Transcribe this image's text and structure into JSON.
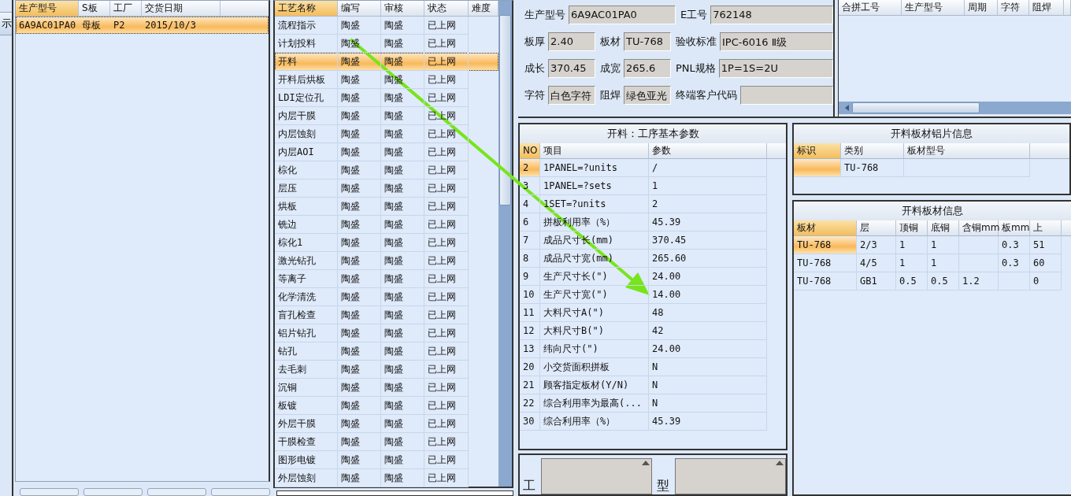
{
  "side_button": {
    "label": "示"
  },
  "orders": {
    "columns": [
      "生产型号",
      "S板",
      "工厂",
      "交货日期"
    ],
    "rows": [
      {
        "cells": [
          "6A9AC01PA0",
          "母板",
          "P2",
          "2015/10/3"
        ],
        "selected": true
      }
    ]
  },
  "processes": {
    "columns": [
      "工艺名称",
      "编写",
      "审核",
      "状态",
      "难度"
    ],
    "rows": [
      {
        "cells": [
          "流程指示",
          "陶盛",
          "陶盛",
          "已上网"
        ],
        "selected": false
      },
      {
        "cells": [
          "计划投料",
          "陶盛",
          "陶盛",
          "已上网"
        ],
        "selected": false
      },
      {
        "cells": [
          "开料",
          "陶盛",
          "陶盛",
          "已上网"
        ],
        "selected": true
      },
      {
        "cells": [
          "开料后烘板",
          "陶盛",
          "陶盛",
          "已上网"
        ],
        "selected": false
      },
      {
        "cells": [
          "LDI定位孔",
          "陶盛",
          "陶盛",
          "已上网"
        ],
        "selected": false
      },
      {
        "cells": [
          "内层干膜",
          "陶盛",
          "陶盛",
          "已上网"
        ],
        "selected": false
      },
      {
        "cells": [
          "内层蚀刻",
          "陶盛",
          "陶盛",
          "已上网"
        ],
        "selected": false
      },
      {
        "cells": [
          "内层AOI",
          "陶盛",
          "陶盛",
          "已上网"
        ],
        "selected": false
      },
      {
        "cells": [
          "棕化",
          "陶盛",
          "陶盛",
          "已上网"
        ],
        "selected": false
      },
      {
        "cells": [
          "层压",
          "陶盛",
          "陶盛",
          "已上网"
        ],
        "selected": false
      },
      {
        "cells": [
          "烘板",
          "陶盛",
          "陶盛",
          "已上网"
        ],
        "selected": false
      },
      {
        "cells": [
          "铣边",
          "陶盛",
          "陶盛",
          "已上网"
        ],
        "selected": false
      },
      {
        "cells": [
          "棕化1",
          "陶盛",
          "陶盛",
          "已上网"
        ],
        "selected": false
      },
      {
        "cells": [
          "激光钻孔",
          "陶盛",
          "陶盛",
          "已上网"
        ],
        "selected": false
      },
      {
        "cells": [
          "等离子",
          "陶盛",
          "陶盛",
          "已上网"
        ],
        "selected": false
      },
      {
        "cells": [
          "化学清洗",
          "陶盛",
          "陶盛",
          "已上网"
        ],
        "selected": false
      },
      {
        "cells": [
          "盲孔检查",
          "陶盛",
          "陶盛",
          "已上网"
        ],
        "selected": false
      },
      {
        "cells": [
          "铝片钻孔",
          "陶盛",
          "陶盛",
          "已上网"
        ],
        "selected": false
      },
      {
        "cells": [
          "钻孔",
          "陶盛",
          "陶盛",
          "已上网"
        ],
        "selected": false
      },
      {
        "cells": [
          "去毛刺",
          "陶盛",
          "陶盛",
          "已上网"
        ],
        "selected": false
      },
      {
        "cells": [
          "沉铜",
          "陶盛",
          "陶盛",
          "已上网"
        ],
        "selected": false
      },
      {
        "cells": [
          "板镀",
          "陶盛",
          "陶盛",
          "已上网"
        ],
        "selected": false
      },
      {
        "cells": [
          "外层干膜",
          "陶盛",
          "陶盛",
          "已上网"
        ],
        "selected": false
      },
      {
        "cells": [
          "干膜检查",
          "陶盛",
          "陶盛",
          "已上网"
        ],
        "selected": false
      },
      {
        "cells": [
          "图形电镀",
          "陶盛",
          "陶盛",
          "已上网"
        ],
        "selected": false
      },
      {
        "cells": [
          "外层蚀刻",
          "陶盛",
          "陶盛",
          "已上网"
        ],
        "selected": false
      }
    ]
  },
  "info_form": {
    "fields": [
      {
        "label": "生产型号",
        "value": "6A9AC01PA0"
      },
      {
        "label": "E工号",
        "value": "762148"
      },
      {
        "label": "板厚",
        "value": "2.40"
      },
      {
        "label": "板材",
        "value": "TU-768"
      },
      {
        "label": "验收标准",
        "value": "IPC-6016 Ⅱ级"
      },
      {
        "label": "成长",
        "value": "370.45"
      },
      {
        "label": "成宽",
        "value": "265.6"
      },
      {
        "label": "PNL规格",
        "value": "1P=1S=2U"
      },
      {
        "label": "字符",
        "value": "白色字符"
      },
      {
        "label": "阻焊",
        "value": "绿色亚光"
      },
      {
        "label": "终端客户代码"
      }
    ]
  },
  "merge_table": {
    "columns": [
      "合拼工号",
      "生产型号",
      "周期",
      "字符",
      "阻焊"
    ]
  },
  "params": {
    "title": "开料：工序基本参数",
    "columns": [
      "NO",
      "项目",
      "参数"
    ],
    "rows": [
      {
        "no": "2",
        "item": "1PANEL=?units",
        "value": "/",
        "selected": true
      },
      {
        "no": "3",
        "item": "1PANEL=?sets",
        "value": "1",
        "selected": false
      },
      {
        "no": "4",
        "item": "1SET=?units",
        "value": "2",
        "selected": false
      },
      {
        "no": "6",
        "item": "拼板利用率（%）",
        "value": "45.39",
        "selected": false
      },
      {
        "no": "7",
        "item": "成品尺寸长(mm)",
        "value": "370.45",
        "selected": false
      },
      {
        "no": "8",
        "item": "成品尺寸宽(mm)",
        "value": "265.60",
        "selected": false
      },
      {
        "no": "9",
        "item": "生产尺寸长(\")",
        "value": "24.00",
        "selected": false
      },
      {
        "no": "10",
        "item": "生产尺寸宽(\")",
        "value": "14.00",
        "selected": false
      },
      {
        "no": "11",
        "item": "大料尺寸A(\")",
        "value": "48",
        "selected": false
      },
      {
        "no": "12",
        "item": "大料尺寸B(\")",
        "value": "42",
        "selected": false
      },
      {
        "no": "13",
        "item": "纬向尺寸(\")",
        "value": "24.00",
        "selected": false
      },
      {
        "no": "20",
        "item": "小交货面积拼板",
        "value": "N",
        "selected": false
      },
      {
        "no": "21",
        "item": "顾客指定板材(Y/N)",
        "value": "N",
        "selected": false
      },
      {
        "no": "22",
        "item": "综合利用率为最高(...",
        "value": "N",
        "selected": false
      },
      {
        "no": "30",
        "item": "综合利用率（%）",
        "value": "45.39",
        "selected": false
      }
    ]
  },
  "foil_info": {
    "title": "开料板材铝片信息",
    "columns": [
      "标识",
      "类别",
      "板材型号"
    ],
    "rows": [
      {
        "category": "TU-768",
        "selected": true
      }
    ]
  },
  "board_info": {
    "title": "开料板材信息",
    "columns": [
      "板材",
      "层",
      "顶铜",
      "底铜",
      "含铜mm",
      "板mm",
      "上"
    ],
    "rows": [
      {
        "cells": [
          "TU-768",
          "2/3",
          "1",
          "1",
          null,
          "0.3",
          "51"
        ],
        "selected": true
      },
      {
        "cells": [
          "TU-768",
          "4/5",
          "1",
          "1",
          null,
          "0.3",
          "60"
        ],
        "selected": false
      },
      {
        "cells": [
          "TU-768",
          "GB1",
          "0.5",
          "0.5",
          "1.2",
          null,
          "0"
        ],
        "selected": false
      }
    ]
  },
  "bottom_fields": {
    "labels": [
      "工",
      "型"
    ]
  }
}
